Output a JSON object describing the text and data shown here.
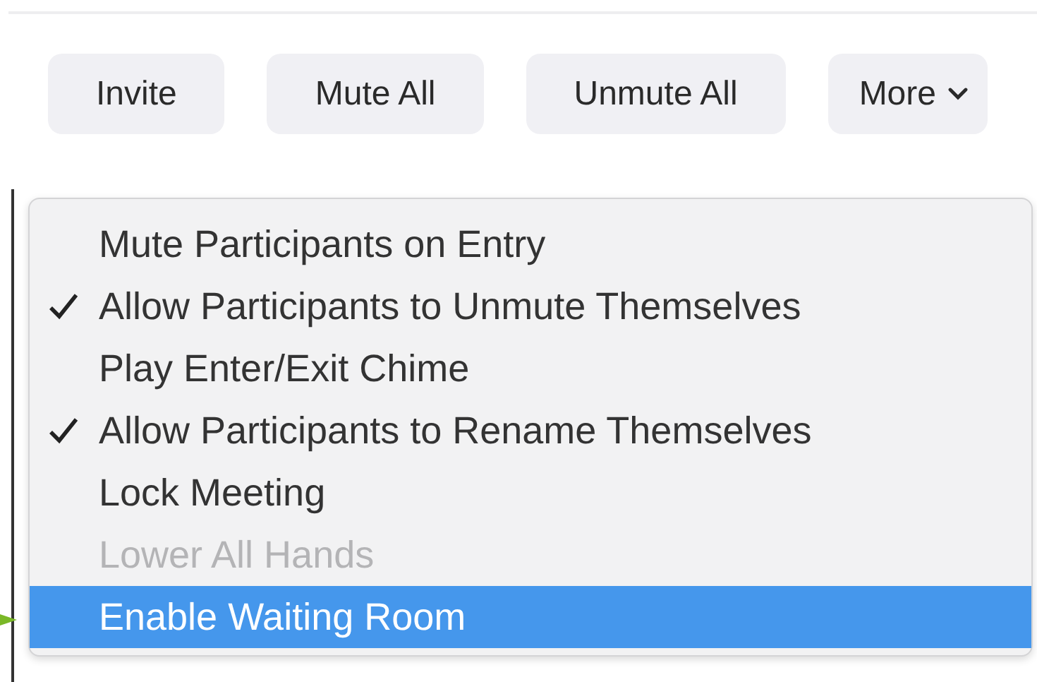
{
  "toolbar": {
    "buttons": [
      {
        "label": "Invite",
        "kind": "plain"
      },
      {
        "label": "Mute All",
        "kind": "plain"
      },
      {
        "label": "Unmute All",
        "kind": "plain"
      },
      {
        "label": "More",
        "kind": "dropdown"
      }
    ]
  },
  "menu": {
    "items": [
      {
        "label": "Mute Participants on Entry",
        "checked": false,
        "disabled": false,
        "selected": false
      },
      {
        "label": "Allow Participants to Unmute Themselves",
        "checked": true,
        "disabled": false,
        "selected": false
      },
      {
        "label": "Play Enter/Exit Chime",
        "checked": false,
        "disabled": false,
        "selected": false
      },
      {
        "label": "Allow Participants to Rename Themselves",
        "checked": true,
        "disabled": false,
        "selected": false
      },
      {
        "label": "Lock Meeting",
        "checked": false,
        "disabled": false,
        "selected": false
      },
      {
        "label": "Lower All Hands",
        "checked": false,
        "disabled": true,
        "selected": false
      },
      {
        "label": "Enable Waiting Room",
        "checked": false,
        "disabled": false,
        "selected": true
      }
    ]
  }
}
